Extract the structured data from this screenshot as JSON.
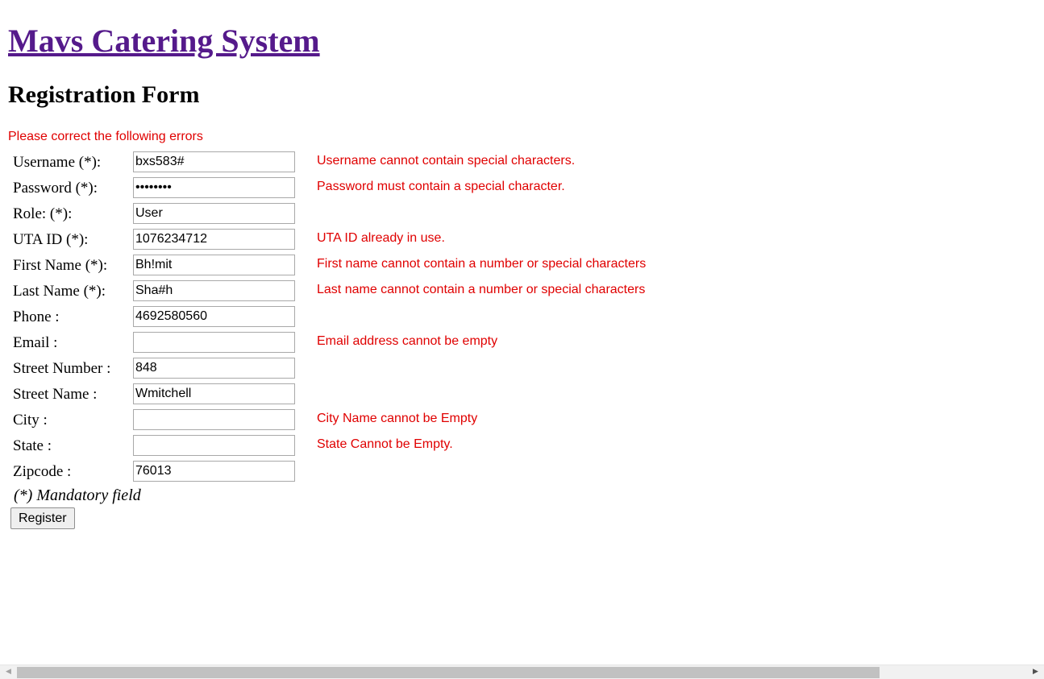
{
  "header": {
    "app_title": "Mavs Catering System",
    "form_title": "Registration Form"
  },
  "errors_heading": "Please correct the following errors",
  "fields": [
    {
      "name": "username",
      "label": "Username (*):",
      "value": "bxs583#",
      "error": "Username cannot contain special characters."
    },
    {
      "name": "password",
      "label": "Password (*):",
      "value": "••••••••",
      "error": "Password must contain a special character."
    },
    {
      "name": "role",
      "label": "Role: (*):",
      "value": "User",
      "error": ""
    },
    {
      "name": "uta-id",
      "label": "UTA ID (*):",
      "value": "1076234712",
      "error": "UTA ID already in use."
    },
    {
      "name": "first-name",
      "label": "First Name (*):",
      "value": "Bh!mit",
      "error": "First name cannot contain a number or special characters"
    },
    {
      "name": "last-name",
      "label": "Last Name (*):",
      "value": "Sha#h",
      "error": "Last name cannot contain a number or special characters"
    },
    {
      "name": "phone",
      "label": "Phone :",
      "value": "4692580560",
      "error": ""
    },
    {
      "name": "email",
      "label": "Email :",
      "value": "",
      "error": "Email address cannot be empty"
    },
    {
      "name": "street-number",
      "label": "Street Number :",
      "value": "848",
      "error": ""
    },
    {
      "name": "street-name",
      "label": "Street Name :",
      "value": "Wmitchell",
      "error": ""
    },
    {
      "name": "city",
      "label": "City :",
      "value": "",
      "error": "City Name cannot be Empty"
    },
    {
      "name": "state",
      "label": "State :",
      "value": "",
      "error": "State Cannot be Empty."
    },
    {
      "name": "zipcode",
      "label": "Zipcode :",
      "value": "76013",
      "error": ""
    }
  ],
  "mandatory_note": "(*) Mandatory field",
  "register_label": "Register",
  "scrollbar": {
    "left_icon": "chevron-left-icon",
    "right_icon": "chevron-right-icon"
  },
  "colors": {
    "link_visited": "#551a8b",
    "error": "#e00000"
  }
}
